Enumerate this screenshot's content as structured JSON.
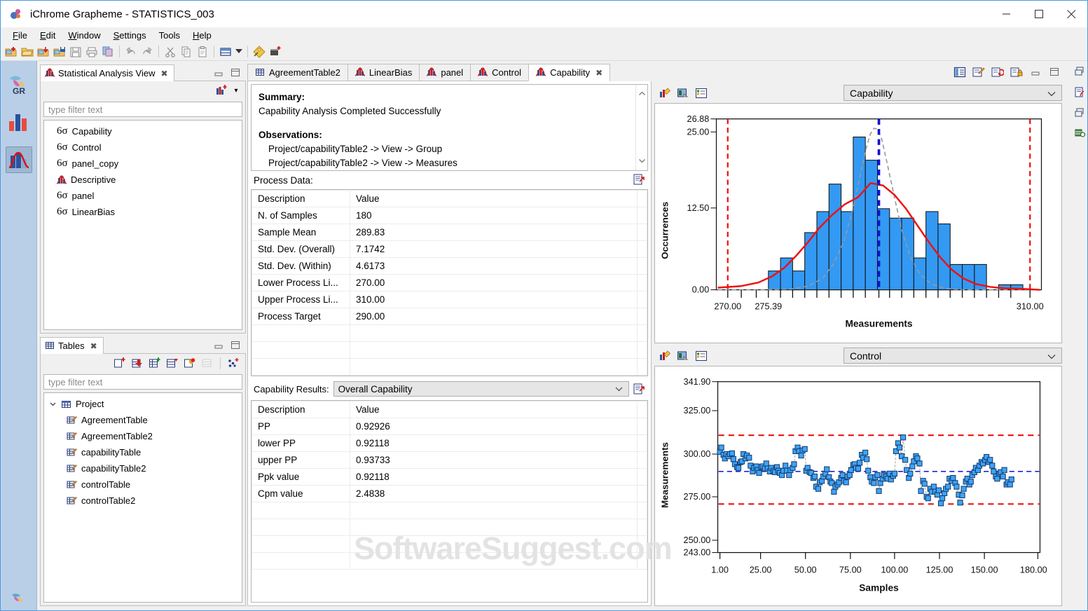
{
  "window": {
    "title": "iChrome Grapheme - STATISTICS_003",
    "app_icon": "grapheme-logo-icon",
    "controls": {
      "minimize": "—",
      "maximize": "□",
      "close": "✕"
    }
  },
  "menu": [
    {
      "label": "File",
      "mnemonic": "F"
    },
    {
      "label": "Edit",
      "mnemonic": "E"
    },
    {
      "label": "Window",
      "mnemonic": "W"
    },
    {
      "label": "Settings",
      "mnemonic": "S"
    },
    {
      "label": "Tools",
      "mnemonic": "T"
    },
    {
      "label": "Help",
      "mnemonic": "H"
    }
  ],
  "toolbar": {
    "items": [
      "new-project-icon",
      "open-folder-icon",
      "import-folder-icon",
      "save-project-icon",
      "save-icon",
      "print-icon",
      "export-icon",
      "sep",
      "undo-icon",
      "redo-icon",
      "sep",
      "cut-icon",
      "copy-icon",
      "paste-icon",
      "sep",
      "layout-icon",
      "layout-dropdown-arrow",
      "sep",
      "tag-icon",
      "new-chart-icon"
    ]
  },
  "rail": {
    "items": [
      {
        "name": "grapheme-gr-icon",
        "label": "GR",
        "active": false
      },
      {
        "name": "bar-chart-perspective-icon",
        "label": "",
        "active": false
      },
      {
        "name": "distribution-curve-perspective-icon",
        "label": "",
        "active": true
      }
    ],
    "bottom_icon": "grapheme-small-logo-icon"
  },
  "statistical_analysis_view": {
    "tab_label": "Statistical Analysis View",
    "tab_icon": "distribution-icon",
    "close_glyph": "✖",
    "toolbar_icon": "new-analysis-icon",
    "toolbar_arrow": "▾",
    "filter_placeholder": "type filter text",
    "items": [
      {
        "label": "Capability",
        "icon": "six-sigma-icon",
        "glyph": "6σ"
      },
      {
        "label": "Control",
        "icon": "six-sigma-icon",
        "glyph": "6σ"
      },
      {
        "label": "panel_copy",
        "icon": "six-sigma-icon",
        "glyph": "6σ"
      },
      {
        "label": "Descriptive",
        "icon": "distribution-icon",
        "glyph": ""
      },
      {
        "label": "panel",
        "icon": "six-sigma-icon",
        "glyph": "6σ"
      },
      {
        "label": "LinearBias",
        "icon": "six-sigma-icon",
        "glyph": "6σ"
      }
    ]
  },
  "tables_view": {
    "tab_label": "Tables",
    "tab_icon": "table-icon",
    "close_glyph": "✖",
    "filter_placeholder": "type filter text",
    "toolbar_icons": [
      "new-table-icon",
      "import-table-icon",
      "add-column-icon",
      "add-row-icon",
      "chart-from-table-icon",
      "table-disabled-icon",
      "scatter-points-icon"
    ],
    "root": {
      "label": "Project",
      "icon": "project-table-icon",
      "expanded": true,
      "chevron": "⌄"
    },
    "children": [
      {
        "label": "AgreementTable",
        "icon": "table-edit-icon"
      },
      {
        "label": "AgreementTable2",
        "icon": "table-edit-icon"
      },
      {
        "label": "capabilityTable",
        "icon": "table-edit-icon"
      },
      {
        "label": "capabilityTable2",
        "icon": "table-edit-icon"
      },
      {
        "label": "controlTable",
        "icon": "table-edit-icon"
      },
      {
        "label": "controlTable2",
        "icon": "table-edit-icon"
      }
    ]
  },
  "editor": {
    "tabs": [
      {
        "label": "AgreementTable2",
        "icon": "table-icon",
        "active": false,
        "closable": false
      },
      {
        "label": "LinearBias",
        "icon": "distribution-icon",
        "active": false,
        "closable": false
      },
      {
        "label": "panel",
        "icon": "distribution-icon",
        "active": false,
        "closable": false
      },
      {
        "label": "Control",
        "icon": "distribution-icon",
        "active": false,
        "closable": false
      },
      {
        "label": "Capability",
        "icon": "distribution-icon",
        "active": true,
        "closable": true,
        "close_glyph": "✖"
      }
    ],
    "toolbar_icons": [
      "outline-view-icon",
      "edit-report-icon",
      "refresh-report-icon",
      "lock-report-icon"
    ],
    "min_glyph": "–",
    "max_glyph": "▭",
    "summary": {
      "heading": "Summary:",
      "text": "Capability Analysis Completed Successfully",
      "observations_heading": "Observations:",
      "observations": [
        "Project/capabilityTable2 -> View -> Group",
        "Project/capabilityTable2 -> View -> Measures"
      ],
      "scroll_up": "⌃",
      "scroll_down": "⌄"
    },
    "process_data": {
      "title": "Process Data:",
      "export_icon": "export-report-icon",
      "columns": [
        "Description",
        "Value"
      ],
      "rows": [
        [
          "N. of Samples",
          "180"
        ],
        [
          "Sample Mean",
          "289.83"
        ],
        [
          "Std. Dev. (Overall)",
          "7.1742"
        ],
        [
          "Std. Dev. (Within)",
          "4.6173"
        ],
        [
          "Lower Process Li...",
          "270.00"
        ],
        [
          "Upper Process Li...",
          "310.00"
        ],
        [
          "Process Target",
          "290.00"
        ]
      ]
    },
    "capability_results": {
      "label": "Capability Results:",
      "selected": "Overall Capability",
      "chevron": "⌄",
      "export_icon": "export-report-icon",
      "columns": [
        "Description",
        "Value"
      ],
      "rows": [
        [
          "PP",
          "0.92926"
        ],
        [
          "lower PP",
          "0.92118"
        ],
        [
          "upper PP",
          "0.93733"
        ],
        [
          "Ppk value",
          "0.92118"
        ],
        [
          "Cpm value",
          "2.4838"
        ]
      ]
    }
  },
  "charts_panel": {
    "top": {
      "selected": "Capability",
      "chevron": "⌄",
      "icons": [
        "chart-properties-icon",
        "chart-export-icon",
        "chart-legend-icon"
      ]
    },
    "bottom": {
      "selected": "Control",
      "chevron": "⌄",
      "icons": [
        "chart-properties-icon",
        "chart-export-icon",
        "chart-legend-icon"
      ]
    }
  },
  "edge_rail": {
    "icons": [
      "restore-view-icon",
      "report-view-icon",
      "restore-view-2-icon",
      "palette-view-icon"
    ]
  },
  "watermark": "SoftwareSuggest.com",
  "chart_data": [
    {
      "type": "bar",
      "id": "capability-histogram",
      "title": "",
      "xlabel": "Measurements",
      "ylabel": "Occurrences",
      "xlim": [
        268.5,
        311.5
      ],
      "ylim": [
        0,
        26.88
      ],
      "ytick_labels": [
        "26.88",
        "25.00",
        "12.50",
        "0.00"
      ],
      "ytick_values": [
        26.88,
        25.0,
        12.5,
        0.0
      ],
      "xtick_labels": [
        "270.00",
        "275.39",
        "310.00"
      ],
      "xtick_values": [
        270.0,
        275.39,
        310.0
      ],
      "bin_width": 1.6,
      "bin_starts": [
        275.4,
        277.0,
        278.6,
        280.2,
        281.8,
        283.4,
        285.0,
        286.6,
        288.2,
        289.8,
        291.4,
        293.0,
        294.6,
        296.2,
        297.8,
        299.4,
        301.0,
        302.6,
        304.2,
        307.4,
        309.0
      ],
      "values": [
        3.0,
        5.0,
        3.0,
        9.0,
        12.3,
        16.6,
        12.3,
        24.0,
        20.3,
        12.7,
        11.3,
        11.3,
        5.0,
        12.3,
        10.3,
        4.0,
        4.0,
        4.0,
        0.0,
        0.8,
        0.8
      ],
      "overlays": [
        {
          "name": "overall-normal-curve",
          "color": "#ee1111",
          "style": "solid",
          "mean": 289.83,
          "sigma": 7.1742,
          "peak": 16.8
        },
        {
          "name": "within-normal-curve",
          "color": "#999999",
          "style": "dashed",
          "mean": 289.83,
          "sigma": 4.6173,
          "peak": 25.9
        },
        {
          "name": "lower-spec-limit",
          "color": "#ee1111",
          "style": "dashed",
          "value": 270.0
        },
        {
          "name": "upper-spec-limit",
          "color": "#ee1111",
          "style": "dashed",
          "value": 310.0
        },
        {
          "name": "process-target-line",
          "color": "#1111cc",
          "style": "dashed",
          "value": 290.0
        }
      ],
      "bar_color": "#3399f3",
      "grid": false,
      "legend": "none"
    },
    {
      "type": "scatter",
      "id": "control-chart",
      "title": "",
      "xlabel": "Samples",
      "ylabel": "Measurements",
      "xlim": [
        1,
        180
      ],
      "ylim": [
        243.0,
        341.9
      ],
      "ytick_labels": [
        "341.90",
        "325.00",
        "300.00",
        "275.00",
        "250.00",
        "243.00"
      ],
      "ytick_values": [
        341.9,
        325.0,
        300.0,
        275.0,
        250.0,
        243.0
      ],
      "xtick_labels": [
        "1.00",
        "25.00",
        "50.00",
        "75.00",
        "100.00",
        "125.00",
        "150.00",
        "180.00"
      ],
      "xtick_values": [
        1,
        25,
        50,
        75,
        100,
        125,
        150,
        180
      ],
      "marker_color": "#3399f3",
      "marker_edge": "#123a6b",
      "control_lines": [
        {
          "name": "upper-control-limit",
          "value": 310.6,
          "color": "#ee1111",
          "style": "dashed"
        },
        {
          "name": "center-line",
          "value": 289.83,
          "color": "#2222dd",
          "style": "dashed"
        },
        {
          "name": "lower-control-limit",
          "value": 271.2,
          "color": "#ee1111",
          "style": "dashed"
        }
      ],
      "x": [
        1,
        2,
        3,
        4,
        5,
        6,
        7,
        8,
        9,
        10,
        11,
        12,
        13,
        14,
        15,
        16,
        17,
        18,
        19,
        20,
        21,
        22,
        23,
        24,
        25,
        26,
        27,
        28,
        29,
        30,
        31,
        32,
        33,
        34,
        35,
        36,
        37,
        38,
        39,
        40,
        41,
        42,
        43,
        44,
        45,
        46,
        47,
        48,
        49,
        50,
        51,
        52,
        53,
        54,
        55,
        56,
        57,
        58,
        59,
        60,
        61,
        62,
        63,
        64,
        65,
        66,
        67,
        68,
        69,
        70,
        71,
        72,
        73,
        74,
        75,
        76,
        77,
        78,
        79,
        80,
        81,
        82,
        83,
        84,
        85,
        86,
        87,
        88,
        89,
        90,
        91,
        92,
        93,
        94,
        95,
        96,
        97,
        98,
        99,
        100,
        101,
        102,
        103,
        104,
        105,
        106,
        107,
        108,
        109,
        110,
        111,
        112,
        113,
        114,
        115,
        116,
        117,
        118,
        119,
        120,
        121,
        122,
        123,
        124,
        125,
        126,
        127,
        128,
        129,
        130,
        131,
        132,
        133,
        134,
        135,
        136,
        137,
        138,
        139,
        140,
        141,
        142,
        143,
        144,
        145,
        146,
        147,
        148,
        149,
        150,
        151,
        152,
        153,
        154,
        155,
        156,
        157,
        158,
        159,
        160,
        161,
        162,
        163,
        164,
        165,
        166,
        167,
        168,
        169,
        170,
        171,
        172,
        173,
        174,
        175,
        176,
        177,
        178,
        179,
        180
      ],
      "y": [
        301.0,
        303.5,
        299.5,
        297.5,
        300.0,
        298.5,
        300.0,
        300.5,
        297.0,
        294.0,
        292.5,
        292.0,
        295.5,
        296.0,
        300.0,
        297.5,
        299.0,
        298.0,
        293.5,
        290.0,
        292.0,
        293.0,
        291.0,
        289.5,
        292.5,
        293.0,
        291.5,
        295.0,
        292.0,
        290.5,
        292.5,
        291.0,
        290.0,
        293.0,
        291.0,
        289.5,
        288.5,
        291.0,
        294.0,
        290.5,
        288.5,
        291.5,
        293.0,
        295.0,
        302.5,
        303.5,
        301.5,
        299.0,
        302.0,
        303.0,
        289.0,
        291.0,
        288.5,
        288.0,
        285.5,
        286.0,
        280.5,
        279.5,
        283.0,
        284.0,
        286.5,
        288.0,
        290.5,
        286.0,
        283.5,
        282.5,
        277.5,
        280.5,
        281.5,
        283.0,
        285.5,
        287.0,
        284.0,
        283.0,
        286.5,
        287.0,
        283.0,
        284.0,
        287.0,
        290.5,
        291.0,
        289.0,
        288.5,
        292.0,
        296.5,
        295.0,
        298.0,
        294.0,
        301.5,
        297.0,
        290.5,
        286.5,
        284.0,
        283.0,
        286.5,
        288.0,
        279.5,
        284.0,
        286.5,
        289.0,
        288.0,
        287.0,
        289.5,
        286.5,
        288.5,
        290.0,
        303.0,
        307.5,
        305.0,
        300.0,
        311.0,
        298.0,
        292.0,
        287.5,
        290.0,
        294.0,
        297.0,
        300.0,
        299.0,
        296.0,
        280.0,
        286.5,
        284.5,
        277.0,
        276.0,
        281.5,
        280.0,
        283.0,
        280.0,
        278.5,
        281.0,
        273.5,
        276.0,
        279.0,
        281.5,
        283.0,
        287.5,
        286.5,
        288.0,
        285.0,
        283.0,
        278.5,
        275.0,
        279.0,
        282.5,
        286.5,
        288.0,
        284.5,
        286.0,
        290.0,
        292.0,
        294.5,
        293.0,
        295.5,
        297.5,
        296.5,
        298.5,
        300.0,
        297.0,
        298.5,
        295.0,
        291.5,
        288.0,
        286.5,
        289.5,
        290.5,
        288.0,
        291.5,
        283.0,
        284.5,
        283.0
      ],
      "grid": false,
      "legend": "none"
    }
  ]
}
